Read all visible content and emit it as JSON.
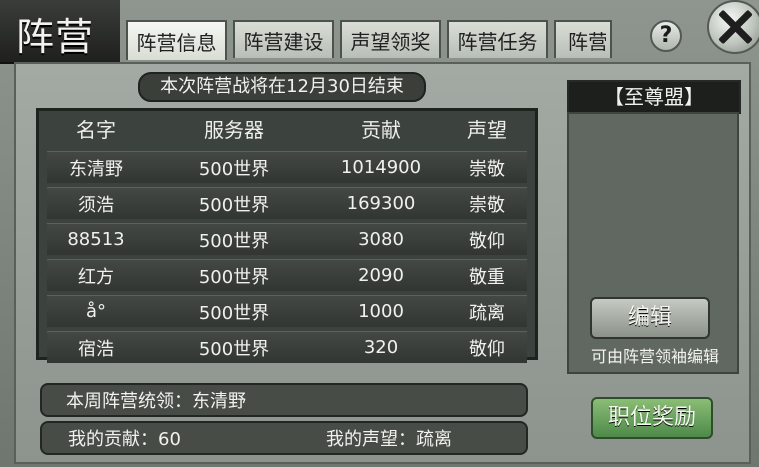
{
  "window": {
    "title": "阵营"
  },
  "tabs": [
    {
      "label": "阵营信息"
    },
    {
      "label": "阵营建设"
    },
    {
      "label": "声望领奖"
    },
    {
      "label": "阵营任务"
    },
    {
      "label": "阵营战"
    }
  ],
  "controls": {
    "help_icon": "?",
    "close_icon": "close-icon"
  },
  "announcement": "本次阵营战将在12月30日结束",
  "table": {
    "headers": [
      "名字",
      "服务器",
      "贡献",
      "声望"
    ],
    "rows": [
      [
        "东清野",
        "500世界",
        "1014900",
        "崇敬"
      ],
      [
        "须浩",
        "500世界",
        "169300",
        "崇敬"
      ],
      [
        "88513",
        "500世界",
        "3080",
        "敬仰"
      ],
      [
        "红方",
        "500世界",
        "2090",
        "敬重"
      ],
      [
        "å°",
        "500世界",
        "1000",
        "疏离"
      ],
      [
        "宿浩",
        "500世界",
        "320",
        "敬仰"
      ]
    ]
  },
  "sidebar": {
    "title": "【至尊盟】",
    "edit_button": "编辑",
    "note": "可由阵营领袖编辑"
  },
  "footer": {
    "leader": "本周阵营统领：东清野",
    "contribution": "我的贡献：60",
    "reputation": "我的声望：疏离",
    "reward_button": "职位奖励"
  }
}
